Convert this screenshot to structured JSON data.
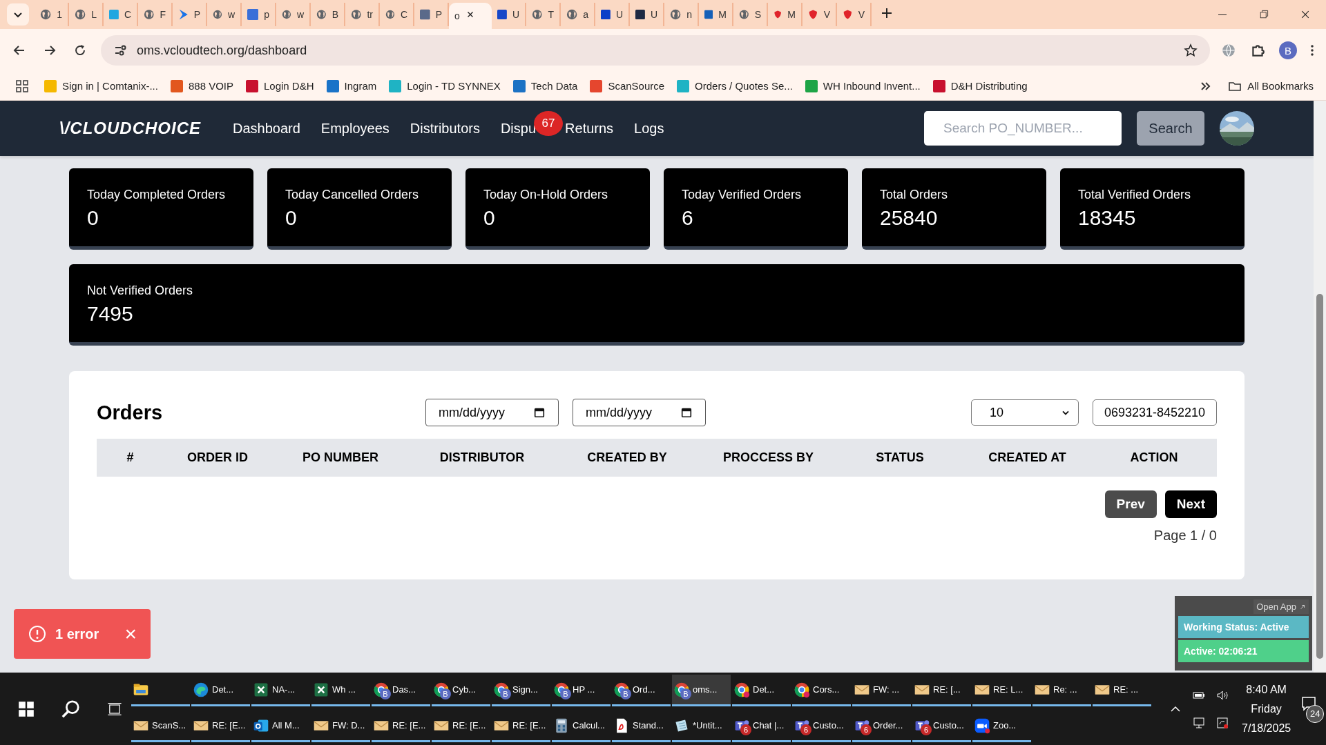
{
  "browser": {
    "tabs": [
      {
        "title": "1",
        "kind": "globe",
        "selected": false
      },
      {
        "title": "L",
        "kind": "globe",
        "selected": false
      },
      {
        "title": "C",
        "kind": "tile",
        "color": "#22a7e0",
        "selected": false
      },
      {
        "title": "F",
        "kind": "globe",
        "selected": false
      },
      {
        "title": "P",
        "kind": "arrow",
        "selected": false
      },
      {
        "title": "w",
        "kind": "globe",
        "selected": false
      },
      {
        "title": "p",
        "kind": "tile",
        "color": "#3b6fd8",
        "selected": false
      },
      {
        "title": "w",
        "kind": "globe",
        "selected": false
      },
      {
        "title": "B",
        "kind": "globe",
        "selected": false
      },
      {
        "title": "tr",
        "kind": "globe",
        "selected": false
      },
      {
        "title": "C",
        "kind": "globe",
        "selected": false
      },
      {
        "title": "P",
        "kind": "tile",
        "color": "#5a6a8a",
        "selected": false
      },
      {
        "title": "o",
        "kind": "none",
        "selected": true
      },
      {
        "title": "U",
        "kind": "tile",
        "color": "#1747c8",
        "selected": false
      },
      {
        "title": "T",
        "kind": "globe",
        "selected": false
      },
      {
        "title": "a",
        "kind": "globe",
        "selected": false
      },
      {
        "title": "U",
        "kind": "tile",
        "color": "#0c3fc8",
        "selected": false
      },
      {
        "title": "U",
        "kind": "tile",
        "color": "#1e2a44",
        "selected": false
      },
      {
        "title": "n",
        "kind": "globe",
        "selected": false
      },
      {
        "title": "M",
        "kind": "tile",
        "color": "#1560b8",
        "selected": false
      },
      {
        "title": "S",
        "kind": "globe",
        "selected": false
      },
      {
        "title": "M",
        "kind": "shield",
        "selected": false
      },
      {
        "title": "V",
        "kind": "shield",
        "selected": false
      },
      {
        "title": "V",
        "kind": "shield",
        "selected": false
      }
    ],
    "url": "oms.vcloudtech.org/dashboard",
    "profile": "B",
    "bookmarks": [
      {
        "label": "Sign in | Comtanix-...",
        "color": "#f5b800"
      },
      {
        "label": "888 VOIP",
        "color": "#e2571e"
      },
      {
        "label": "Login D&H",
        "color": "#c8102e"
      },
      {
        "label": "Ingram",
        "color": "#1a73c8"
      },
      {
        "label": "Login - TD SYNNEX",
        "color": "#1fb3c4"
      },
      {
        "label": "Tech Data",
        "color": "#1c72c4"
      },
      {
        "label": "ScanSource",
        "color": "#e5462e"
      },
      {
        "label": "Orders / Quotes Se...",
        "color": "#1fb3c4"
      },
      {
        "label": "WH Inbound Invent...",
        "color": "#1ea446"
      },
      {
        "label": "D&H Distributing",
        "color": "#c8102e"
      }
    ],
    "all_bookmarks": "All Bookmarks"
  },
  "app": {
    "logo": "\\/CLOUDCHOICE",
    "nav": [
      {
        "label": "Dashboard"
      },
      {
        "label": "Employees"
      },
      {
        "label": "Distributors"
      },
      {
        "label": "Dispu",
        "badge": "67"
      },
      {
        "label": "Returns"
      },
      {
        "label": "Logs"
      }
    ],
    "search": {
      "placeholder": "Search PO_NUMBER...",
      "button": "Search"
    },
    "stats": [
      {
        "label": "Today Completed Orders",
        "value": "0"
      },
      {
        "label": "Today Cancelled Orders",
        "value": "0"
      },
      {
        "label": "Today On-Hold Orders",
        "value": "0"
      },
      {
        "label": "Today Verified Orders",
        "value": "6"
      },
      {
        "label": "Total Orders",
        "value": "25840"
      },
      {
        "label": "Total Verified Orders",
        "value": "18345"
      },
      {
        "label": "Not Verified Orders",
        "value": "7495"
      }
    ],
    "orders": {
      "title": "Orders",
      "date_from": "mm/dd/yyyy",
      "date_to": "mm/dd/yyyy",
      "page_size": "10",
      "po_filter": "0693231-8452210",
      "columns": [
        "#",
        "ORDER ID",
        "PO NUMBER",
        "DISTRIBUTOR",
        "CREATED BY",
        "PROCCESS BY",
        "STATUS",
        "CREATED AT",
        "ACTION"
      ],
      "prev": "Prev",
      "next": "Next",
      "page_info": "Page 1 / 0"
    },
    "toast": {
      "text": "1 error",
      "close": "×"
    },
    "widget": {
      "open_app": "Open App",
      "working_status": "Working Status: Active",
      "active_time": "Active: 02:06:21"
    }
  },
  "taskbar": {
    "rows": [
      [
        {
          "kind": "folder"
        },
        {
          "kind": "edge",
          "label": "Det..."
        },
        {
          "kind": "excel",
          "label": "NA-..."
        },
        {
          "kind": "excel",
          "label": "Wh ..."
        },
        {
          "kind": "chrome",
          "label": "Das...",
          "badge": "B",
          "selected": false
        },
        {
          "kind": "chrome",
          "label": "Cyb...",
          "badge": "B",
          "selected": false
        },
        {
          "kind": "chrome",
          "label": "Sign...",
          "badge": "B",
          "selected": false
        },
        {
          "kind": "chrome",
          "label": "HP ...",
          "badge": "B",
          "selected": false
        },
        {
          "kind": "chrome",
          "label": "Ord...",
          "badge": "B",
          "selected": false
        },
        {
          "kind": "chrome",
          "label": "oms...",
          "badge": "B",
          "selected": true
        },
        {
          "kind": "chrome-dot",
          "label": "Det..."
        },
        {
          "kind": "chrome-dot",
          "label": "Cors..."
        },
        {
          "kind": "mail",
          "label": "FW: ..."
        },
        {
          "kind": "mail",
          "label": "RE: [..."
        },
        {
          "kind": "mail",
          "label": "RE: L..."
        },
        {
          "kind": "mail",
          "label": "Re: ..."
        },
        {
          "kind": "mail",
          "label": "RE: ..."
        }
      ],
      [
        {
          "kind": "mail",
          "label": "ScanS..."
        },
        {
          "kind": "mail",
          "label": "RE: [E..."
        },
        {
          "kind": "outlook",
          "label": "All M..."
        },
        {
          "kind": "mail",
          "label": "FW: D..."
        },
        {
          "kind": "mail",
          "label": "RE: [E..."
        },
        {
          "kind": "mail",
          "label": "RE: [E..."
        },
        {
          "kind": "mail",
          "label": "RE: [E..."
        },
        {
          "kind": "calculator",
          "label": "Calcul..."
        },
        {
          "kind": "pdf",
          "label": "Stand..."
        },
        {
          "kind": "notepad",
          "label": "*Untit..."
        },
        {
          "kind": "teams",
          "label": "Chat |...",
          "badge": "6"
        },
        {
          "kind": "teams",
          "label": "Custo...",
          "badge": "6"
        },
        {
          "kind": "teams",
          "label": "Order...",
          "badge": "6"
        },
        {
          "kind": "teams",
          "label": "Custo...",
          "badge": "6"
        },
        {
          "kind": "zoom",
          "label": "Zoo..."
        }
      ]
    ],
    "time": "8:40 AM",
    "day": "Friday",
    "date": "7/18/2025",
    "notifications": "24"
  }
}
